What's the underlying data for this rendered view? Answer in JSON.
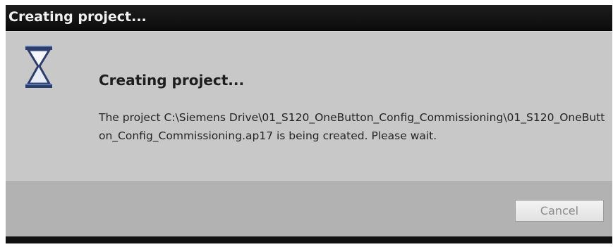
{
  "window": {
    "title": "Creating project..."
  },
  "dialog": {
    "icon": "hourglass-icon",
    "heading": "Creating project...",
    "message": "The project C:\\Siemens Drive\\01_S120_OneButton_Config_Commissioning\\01_S120_OneButton_Config_Commissioning.ap17 is being created. Please wait."
  },
  "buttons": {
    "cancel_label": "Cancel",
    "cancel_enabled": false
  },
  "colors": {
    "titlebar": "#111111",
    "content_background": "#c8c8c8",
    "footer_background": "#b2b2b2"
  }
}
